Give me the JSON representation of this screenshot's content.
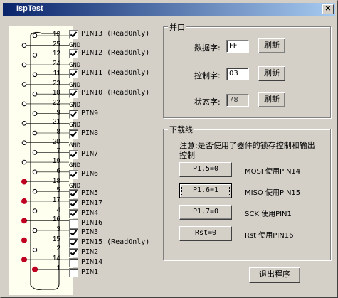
{
  "window": {
    "title": "IspTest",
    "close_glyph": "✕"
  },
  "connector": {
    "pin_numbers": [
      "13",
      "25",
      "12",
      "24",
      "11",
      "23",
      "10",
      "22",
      "9",
      "21",
      "8",
      "20",
      "7",
      "19",
      "6",
      "18",
      "5",
      "17",
      "4",
      "16",
      "3",
      "15",
      "2",
      "14",
      "1"
    ],
    "active_pins": [
      "18",
      "17",
      "16",
      "15",
      "14",
      "1"
    ],
    "active_color": "#c00020"
  },
  "pins": [
    {
      "label": "PIN13 (ReadOnly)",
      "checked": true
    },
    {
      "label": "PIN12 (ReadOnly)",
      "checked": true
    },
    {
      "label": "PIN11 (ReadOnly)",
      "checked": true
    },
    {
      "label": "PIN10 (ReadOnly)",
      "checked": true
    },
    {
      "label": "PIN9",
      "checked": true
    },
    {
      "label": "PIN8",
      "checked": true
    },
    {
      "label": "PIN7",
      "checked": true
    },
    {
      "label": "PIN6",
      "checked": true
    },
    {
      "label": "PIN5",
      "checked": true
    },
    {
      "label": "PIN17",
      "checked": true
    },
    {
      "label": "PIN4",
      "checked": true
    },
    {
      "label": "PIN16",
      "checked": false
    },
    {
      "label": "PIN3",
      "checked": true
    },
    {
      "label": "PIN15 (ReadOnly)",
      "checked": true
    },
    {
      "label": "PIN2",
      "checked": true
    },
    {
      "label": "PIN14",
      "checked": false
    },
    {
      "label": "PIN1",
      "checked": false
    }
  ],
  "gnd_label": "GND",
  "parallel": {
    "title": "并口",
    "data_label": "数据字:",
    "data_value": "FF",
    "control_label": "控制字:",
    "control_value": "03",
    "status_label": "状态字:",
    "status_value": "78",
    "refresh_label": "刷新"
  },
  "download": {
    "title": "下载线",
    "note": "注意:是否使用了器件的锁存控制和输出控制",
    "rows": [
      {
        "button": "P1.5=0",
        "desc": "MOSI 使用PIN14"
      },
      {
        "button": "P1.6=1",
        "desc": "MISO 使用PIN15"
      },
      {
        "button": "P1.7=0",
        "desc": "SCK 使用PIN1"
      },
      {
        "button": "Rst=0",
        "desc": "Rst 使用PIN16"
      }
    ]
  },
  "exit_label": "退出程序"
}
